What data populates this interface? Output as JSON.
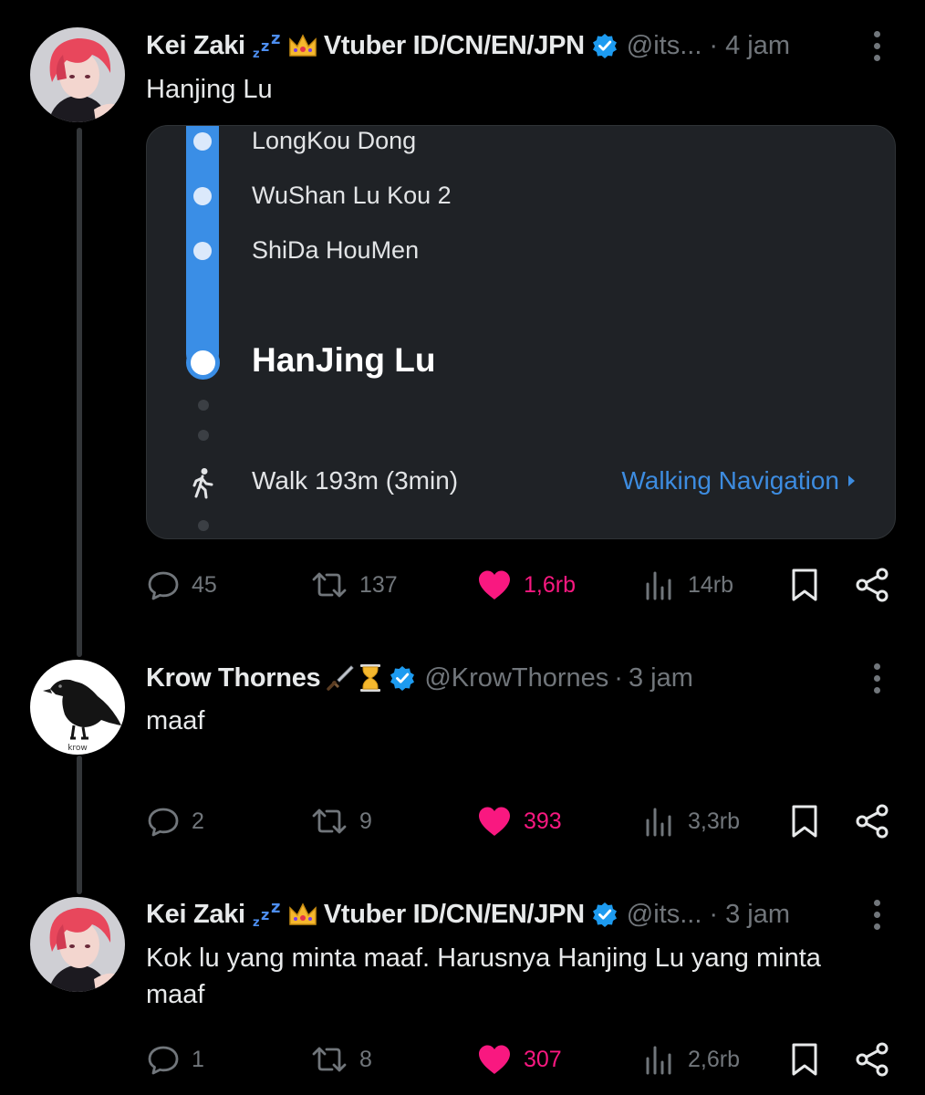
{
  "thread": [
    {
      "author": {
        "name": "Kei Zaki",
        "handle": "@its...",
        "verified": true,
        "avatar": "red-haired-anime-avatar"
      },
      "emoji": [
        "zzz",
        "crown"
      ],
      "vtuber_tag": "Vtuber ID/CN/EN/JPN",
      "time": "4 jam",
      "text": "Hanjing Lu",
      "card": {
        "stops": [
          "LongKou Dong",
          "WuShan Lu Kou 2",
          "ShiDa HouMen"
        ],
        "destination": "HanJing Lu",
        "walk": "Walk 193m (3min)",
        "nav_link": "Walking Navigation"
      },
      "stats": {
        "replies": "45",
        "reposts": "137",
        "likes": "1,6rb",
        "views": "14rb"
      }
    },
    {
      "author": {
        "name": "Krow Thornes",
        "handle": "@KrowThornes",
        "verified": true,
        "avatar": "crow-avatar",
        "avatar_caption": "krow"
      },
      "emoji": [
        "dagger",
        "hourglass"
      ],
      "time": "3 jam",
      "text": "maaf",
      "stats": {
        "replies": "2",
        "reposts": "9",
        "likes": "393",
        "views": "3,3rb"
      }
    },
    {
      "author": {
        "name": "Kei Zaki",
        "handle": "@its...",
        "verified": true,
        "avatar": "red-haired-anime-avatar"
      },
      "emoji": [
        "zzz",
        "crown"
      ],
      "vtuber_tag": "Vtuber ID/CN/EN/JPN",
      "time": "3 jam",
      "text": "Kok lu yang minta maaf. Harusnya Hanjing Lu yang minta maaf",
      "stats": {
        "replies": "1",
        "reposts": "8",
        "likes": "307",
        "views": "2,6rb"
      }
    }
  ],
  "colors": {
    "background": "#000000",
    "like": "#f91880",
    "verified": "#1d9bf0",
    "route": "#3a8ee6",
    "muted": "#71767b"
  }
}
